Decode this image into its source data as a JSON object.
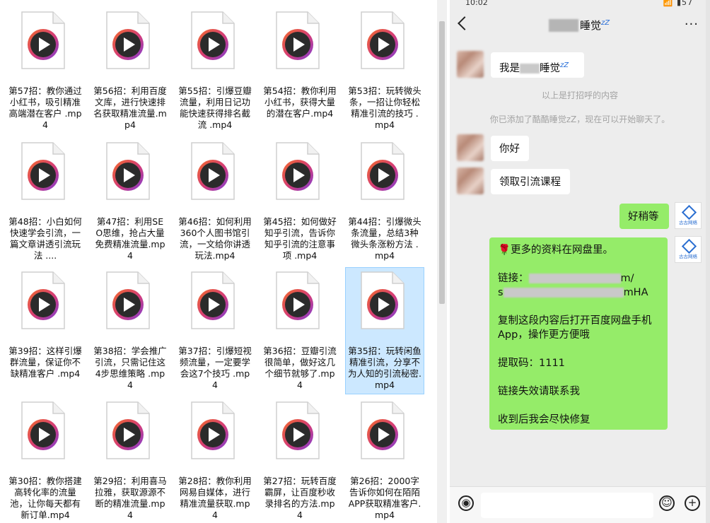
{
  "files": [
    {
      "name": "第57招：教你通过小红书，吸引精准高端潜在客户 .mp4"
    },
    {
      "name": "第56招：利用百度文库，进行快速排名获取精准流量.mp4"
    },
    {
      "name": "第55招：引爆豆瓣流量，利用日记功能快速获得排名截流 .mp4"
    },
    {
      "name": "第54招：教你利用小红书，获得大量的潜在客户.mp4"
    },
    {
      "name": "第53招：玩转微头条，一招让你轻松精准引流的技巧 .mp4"
    },
    {
      "name": "第48招：小白如何快速学会引流，一篇文章讲透引流玩法 ...."
    },
    {
      "name": "第47招：利用SEO思维，抢占大量免费精准流量.mp4"
    },
    {
      "name": "第46招：如何利用360个人图书馆引流，一文给你讲透玩法.mp4"
    },
    {
      "name": "第45招：如何做好知乎引流，告诉你知乎引流的注意事项 .mp4"
    },
    {
      "name": "第44招：引爆微头条流量，总结3种微头条涨粉方法 .mp4"
    },
    {
      "name": "第39招：这样引爆群流量，保证你不缺精准客户 .mp4"
    },
    {
      "name": "第38招：学会推广引流，只需记住这4步思维策略 .mp4"
    },
    {
      "name": "第37招：引爆短视频流量，一定要学会这7个技巧 .mp4"
    },
    {
      "name": "第36招：豆瓣引流很简单，做好这几个细节就够了.mp4"
    },
    {
      "name": "第35招：玩转闲鱼精准引流，分享不为人知的引流秘密.mp4",
      "selected": true
    },
    {
      "name": "第30招：教你搭建高转化率的流量池，让你每天都有新订单.mp4"
    },
    {
      "name": "第29招：利用喜马拉雅，获取源源不断的精准流量.mp4"
    },
    {
      "name": "第28招：教你利用网易自媒体，进行精准流量获取.mp4"
    },
    {
      "name": "第27招：玩转百度霸屏，让百度秒收录排名的方法.mp4"
    },
    {
      "name": "第26招：2000字告诉你如何在陌陌APP获取精准客户.mp4"
    }
  ],
  "phone": {
    "status_time": "10:02",
    "status_right": "57",
    "chat_title": "睡觉",
    "chat_title_zz": "zZ",
    "more_icon": "···",
    "messages": {
      "m1": "我是",
      "m1b": "睡觉",
      "sys1": "以上是打招呼的内容",
      "sys2": "你已添加了酷酷睡觉zZ，现在可以开始聊天了。",
      "m2": "你好",
      "m3": "领取引流课程",
      "m4": "好稍等",
      "panel": {
        "line1": "🌹更多的资料在网盘里。",
        "link_label": "链接：",
        "link_tail1": "m/",
        "link_head2": "s",
        "link_tail2": "mHA",
        "line3a": "复制这段内容后打开百度网盘手机",
        "line3b": "App，操作更方便哦",
        "code": "提取码：1111",
        "line5": "链接失效请联系我",
        "line6": "收到后我会尽快修复"
      }
    },
    "logo_text": "古古网络",
    "voice_icon": "voice-icon",
    "emoji_icon": "emoji-icon",
    "plus_icon": "plus-icon"
  }
}
